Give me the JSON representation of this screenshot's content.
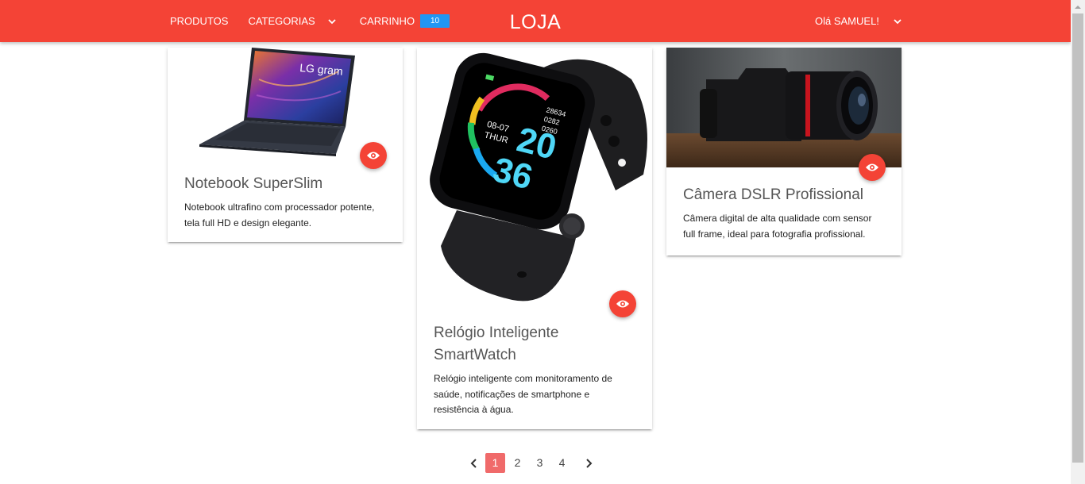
{
  "nav": {
    "products": "PRODUTOS",
    "categories": "CATEGORIAS",
    "cart": "CARRINHO",
    "cart_count": "10",
    "brand": "LOJA",
    "greeting": "Olá SAMUEL!"
  },
  "products": [
    {
      "title": "Notebook SuperSlim",
      "description": "Notebook ultrafino com processador potente, tela full HD e design elegante.",
      "image_brand_text": "LG gram"
    },
    {
      "title": "Relógio Inteligente SmartWatch",
      "description": "Relógio inteligente com monitoramento de saúde, notificações de smartphone e resistência à água.",
      "watch_face": {
        "hour": "20",
        "minute": "36",
        "date": "08-07",
        "day": "THUR",
        "steps": "28634",
        "calories": "0282",
        "distance": "0260"
      }
    },
    {
      "title": "Câmera DSLR Profissional",
      "description": "Câmera digital de alta qualidade com sensor full frame, ideal para fotografia profissional."
    }
  ],
  "pagination": {
    "pages": [
      "1",
      "2",
      "3",
      "4"
    ],
    "current": "1"
  },
  "colors": {
    "primary": "#f44336",
    "badge": "#2196f3",
    "active_page": "#f06a6a"
  }
}
